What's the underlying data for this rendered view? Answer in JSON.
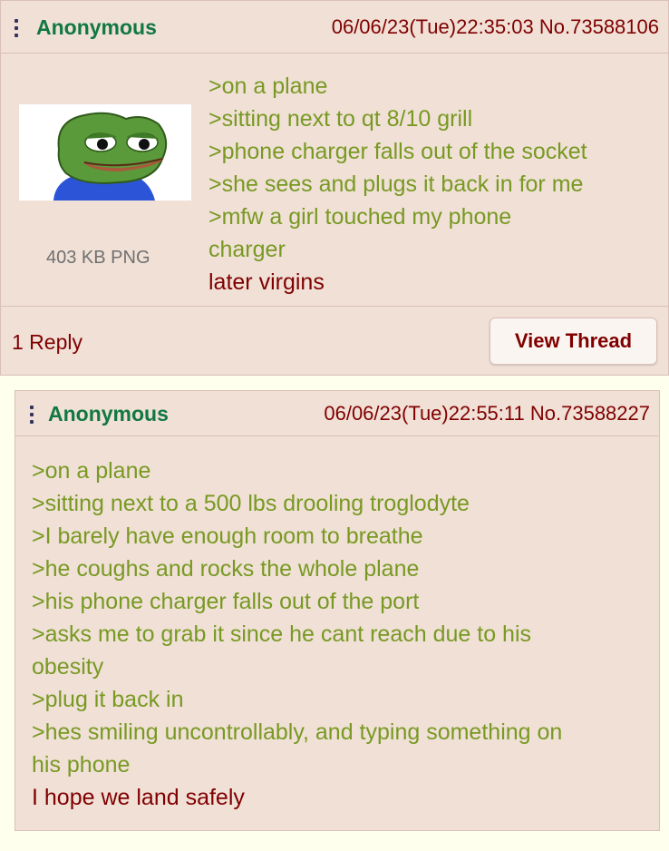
{
  "colors": {
    "page_background": "#ffffee",
    "post_background": "#f0e0d6",
    "name": "#117743",
    "greentext": "#789922",
    "text": "#800000"
  },
  "op": {
    "name": "Anonymous",
    "date": "06/06/23(Tue)22:35:03",
    "post_number": "No.73588106",
    "file_info": "403 KB PNG",
    "thumbnail_icon": "pepe-frog-thumbnail",
    "lines": [
      ">on a plane",
      ">sitting next to qt 8/10 grill",
      ">phone charger falls out of the socket",
      ">she sees and plugs it back in for me",
      ">mfw a girl touched my phone",
      "charger",
      "later virgins"
    ],
    "reply_count": "1 Reply",
    "view_thread_label": "View Thread"
  },
  "reply": {
    "name": "Anonymous",
    "date": "06/06/23(Tue)22:55:11",
    "post_number": "No.73588227",
    "lines": [
      ">on a plane",
      ">sitting next to a 500 lbs drooling troglodyte",
      ">I barely have enough room to breathe",
      ">he coughs and rocks the whole plane",
      ">his phone charger falls out of the port",
      ">asks me to grab it since he cant reach due to his",
      "obesity",
      ">plug it back in",
      ">hes smiling uncontrollably, and typing something on",
      "his phone",
      "I hope we land safely"
    ]
  }
}
